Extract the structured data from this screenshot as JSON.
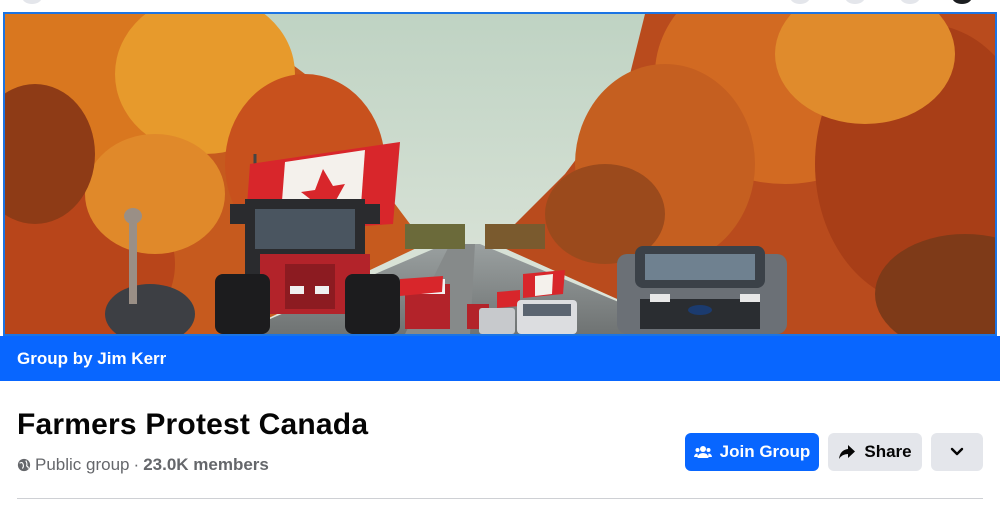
{
  "cover": {
    "image_name": "cover-photo",
    "banner_text": "Group by Jim Kerr"
  },
  "group": {
    "name": "Farmers Protest Canada",
    "privacy": "Public group",
    "separator": "·",
    "members": "23.0K members"
  },
  "actions": {
    "join_label": "Join Group",
    "share_label": "Share",
    "more_icon": "chevron-down-icon"
  },
  "colors": {
    "primary": "#0866ff",
    "secondary_button": "#e4e6eb",
    "text_primary": "#050505",
    "text_secondary": "#65676b"
  }
}
